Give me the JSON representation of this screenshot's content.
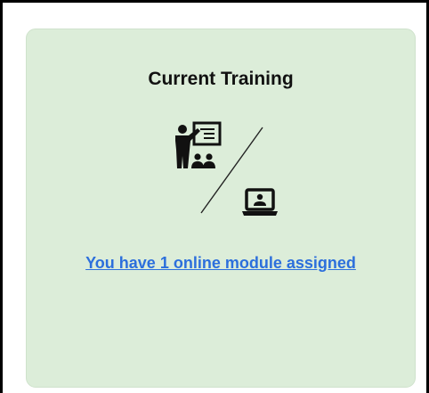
{
  "card": {
    "title": "Current Training",
    "icon": "in-person-vs-online-training-icon",
    "link_text": "You have 1 online module assigned"
  },
  "colors": {
    "card_background": "#dcedd9",
    "link": "#2c6fdc",
    "title": "#111111"
  }
}
